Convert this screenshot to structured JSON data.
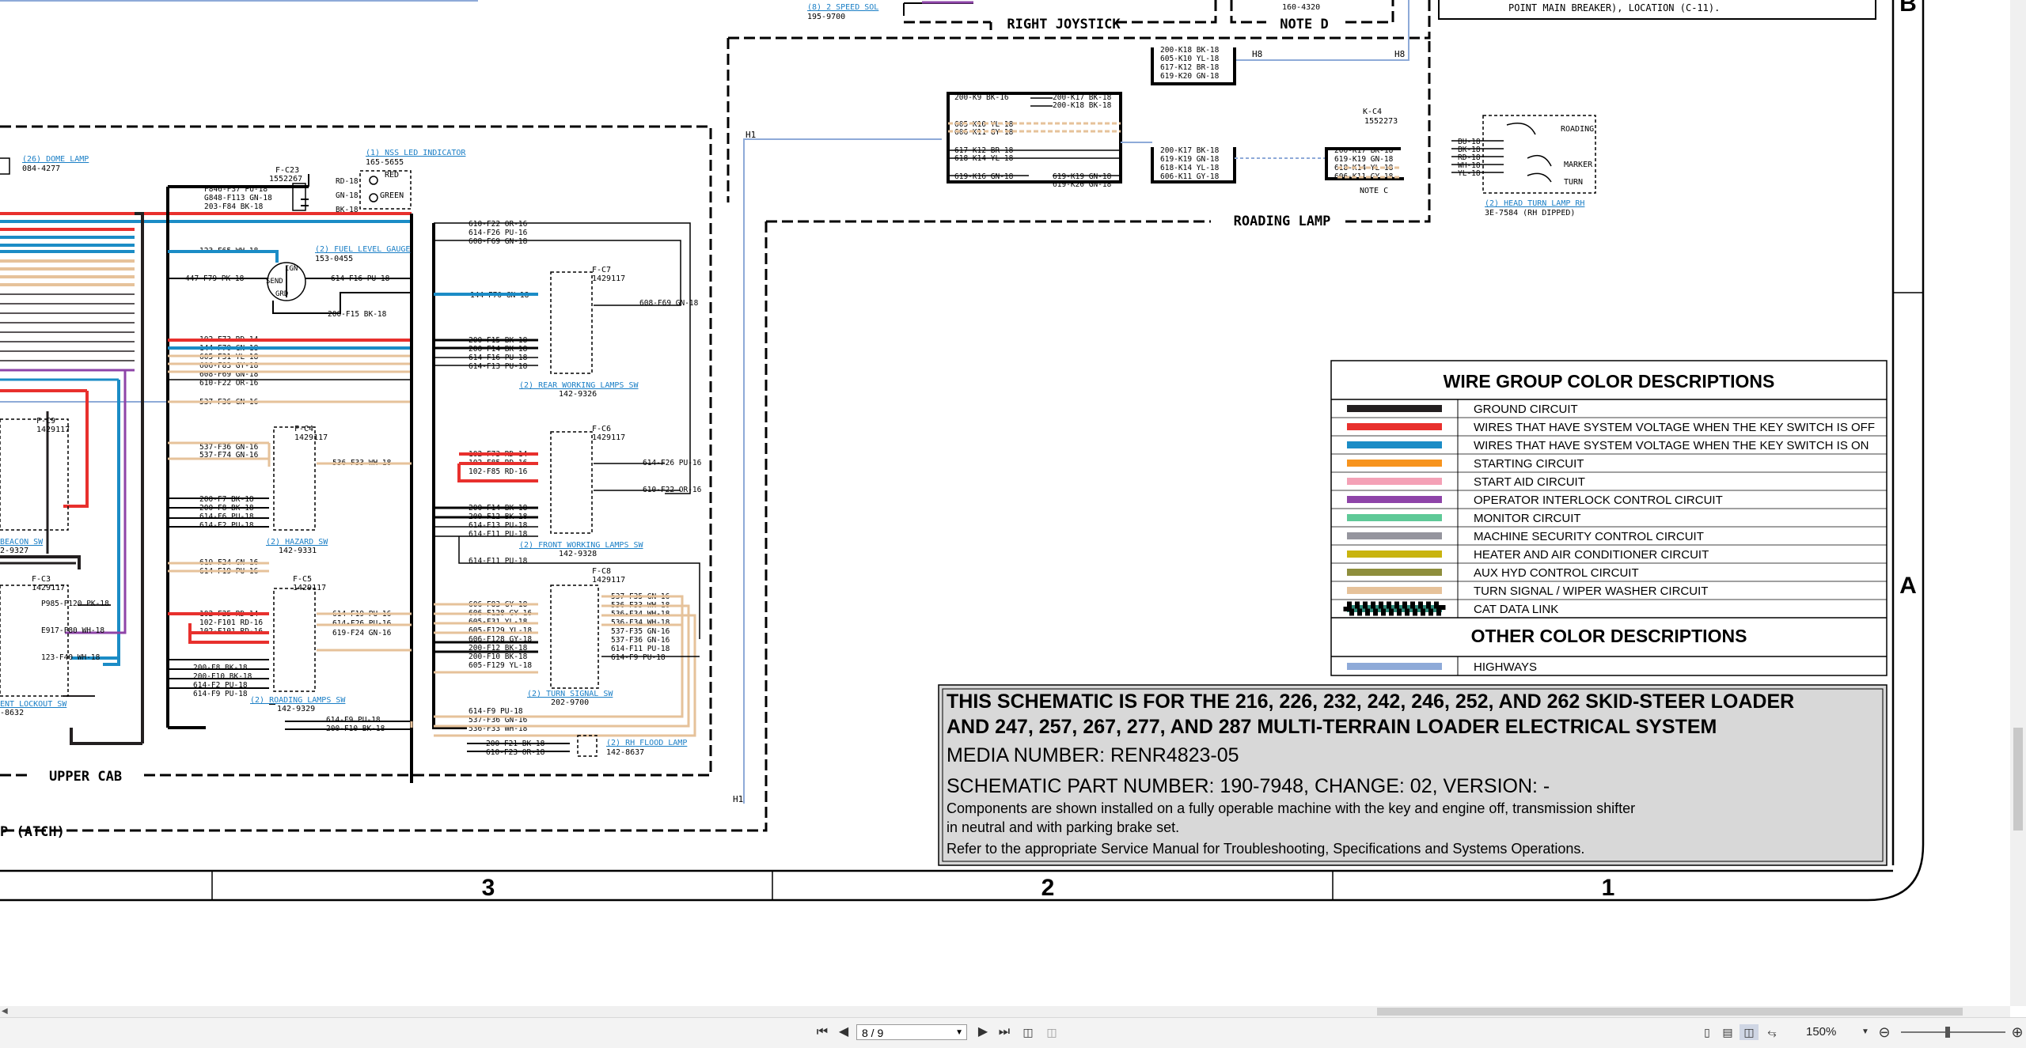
{
  "schematic": {
    "top_labels": {
      "speed_sol_link": "(8) 2 SPEED SOL",
      "speed_sol_part": "195-9700",
      "right_joystick": "RIGHT JOYSTICK",
      "note_d": "NOTE D",
      "part_160_4320": "160-4320",
      "main_breaker_note": "POINT MAIN BREAKER), LOCATION (C-11).",
      "h8_a": "H8",
      "h8_b": "H8",
      "h1_a": "H1",
      "h1_b": "H1",
      "roading_lamp": "ROADING LAMP",
      "upper_cab": "UPPER CAB",
      "atch": "P (ATCH)",
      "note_c": "NOTE C"
    },
    "zone_left": {
      "dome_lamp_link": "(26) DOME LAMP",
      "dome_lamp_part": "084-4277",
      "nss_led_link": "(1) NSS LED INDICATOR",
      "nss_led_part": "165-5655",
      "fc23": "F-C23",
      "fc23_part": "1552267",
      "red": "RED",
      "green": "GREEN",
      "fuel_gauge_link": "(2) FUEL LEVEL GAUGE",
      "fuel_gauge_part": "153-0455",
      "ign": "IGN",
      "send": "SEND",
      "grd": "GRD",
      "fc9": "F-C9",
      "fc9_part": "1429117",
      "fc4": "F-C4",
      "fc4_part": "1429117",
      "fc3": "F-C3",
      "fc3_part": "1429117",
      "fc5": "F-C5",
      "fc5_part": "1429117",
      "beacon_link": "BEACON SW",
      "beacon_part": "2-9327",
      "hazard_link": "(2) HAZARD SW",
      "hazard_part": "142-9331",
      "lockout_link": "ENT LOCKOUT SW",
      "lockout_part": "-8632",
      "roading_sw_link": "(2) ROADING LAMPS SW",
      "roading_sw_part": "142-9329"
    },
    "zone_mid": {
      "fc7": "F-C7",
      "fc7_part": "1429117",
      "rear_link": "(2) REAR WORKING LAMPS SW",
      "rear_part": "142-9326",
      "fc6": "F-C6",
      "fc6_part": "1429117",
      "front_link": "(2) FRONT WORKING LAMPS SW",
      "front_part": "142-9328",
      "fc8": "F-C8",
      "fc8_part": "1429117",
      "turn_link": "(2) TURN SIGNAL SW",
      "turn_part": "202-9700",
      "flood_link": "(2) RH FLOOD LAMP",
      "flood_part": "142-8637"
    },
    "zone_right": {
      "kc4": "K-C4",
      "kc4_part": "1552273",
      "head_turn_link": "(2) HEAD TURN LAMP RH",
      "head_turn_part": "3E-7584 (RH DIPPED)",
      "roading": "ROADING",
      "marker": "MARKER",
      "turn": "TURN"
    }
  },
  "wire_labels": {
    "z1_top": [
      "F846-F37 PU-18",
      "G848-F113 GN-18",
      "203-F84 BK-18"
    ],
    "z1_nss": [
      "RD-18",
      "GN-18",
      "BK-18"
    ],
    "z1_a": [
      "123-F65 WH-18"
    ],
    "z1_b": [
      "447-F79 PK-18"
    ],
    "z1_c": [
      "614-F16 PU-18",
      "200-F15 BK-18"
    ],
    "z1_bundle": [
      "102-F73 RD-14",
      "144-F70 GN-18",
      "605-F31 YL-18",
      "606-F83 GY-18",
      "608-F69 GN-18",
      "610-F22 OR-16"
    ],
    "z1_d": [
      "537-F36 GN-16"
    ],
    "z1_e": [
      "537-F36 GN-16",
      "537-F74 GN-16",
      "536-F33 WH-18"
    ],
    "z1_f": [
      "200-F7 BK-18",
      "200-F8 BK-18",
      "614-F6 PU-18",
      "614-F2 PU-18"
    ],
    "z1_g": [
      "619-F24 GN-16",
      "614-F19 PU-16"
    ],
    "z1_h": [
      "102-F25 RD-14",
      "102-F101 RD-16",
      "102-F101 RD-16"
    ],
    "z1_i": [
      "614-F19 PU-16",
      "614-F26 PU-16",
      "619-F24 GN-16"
    ],
    "z1_j": [
      "200-F8 BK-18",
      "200-F10 BK-18",
      "614-F2 PU-18",
      "614-F9 PU-18"
    ],
    "z1_k": [
      "P985-F120 PK-18",
      "E917-F80 WH-18",
      "123-F40 WH-18"
    ],
    "z1_l": [
      "614-F9 PU-18",
      "200-F10 BK-18"
    ],
    "z2_top": [
      "610-F22 OR-16",
      "614-F26 PU-16",
      "608-F69 GN-18"
    ],
    "z2_a": [
      "144-F70 GN-18",
      "608-F69 GN-18"
    ],
    "z2_b": [
      "200-F15 BK-18",
      "200-F14 BK-18",
      "614-F16 PU-18",
      "614-F13 PU-18"
    ],
    "z2_c": [
      "102-F73 RD-14",
      "102-F85 RD-16",
      "102-F85 RD-16",
      "614-F26 PU-16",
      "610-F22 OR-16"
    ],
    "z2_d": [
      "200-F14 BK-18",
      "200-F12 BK-18",
      "614-F13 PU-18",
      "614-F11 PU-18"
    ],
    "z2_e": [
      "614-F11 PU-18"
    ],
    "z2_f": [
      "606-F83 GY-18",
      "606-F128 GY-16",
      "605-F31 YL-18",
      "605-F129 YL-18",
      "606-F128 GY-18",
      "200-F12 BK-18",
      "200-F10 BK-18",
      "605-F129 YL-18"
    ],
    "z2_g": [
      "537-F35 GN-16",
      "536-F33 WH-18",
      "536-F34 WH-18",
      "536-F34 WH-18",
      "537-F35 GN-16",
      "537-F36 GN-16",
      "614-F11 PU-18",
      "614-F9 PU-18"
    ],
    "z2_h": [
      "614-F9 PU-18",
      "537-F36 GN-16",
      "536-F33 WH-18"
    ],
    "z2_i": [
      "200-F21 BK-18",
      "610-F23 OR-18"
    ],
    "z3_top": [
      "200-K18 BK-18",
      "605-K10 YL-18",
      "617-K12 BR-18",
      "619-K20 GN-18"
    ],
    "z3_a": [
      "200-K9 BK-16",
      "200-K17 BK-18",
      "200-K18 BK-18"
    ],
    "z3_b": [
      "605-K10 YL-18",
      "606-K11 GY-18"
    ],
    "z3_c": [
      "617-K12 BR-18",
      "618-K14 YL-18"
    ],
    "z3_d": [
      "619-K16 GN-18",
      "619-K19 GN-18",
      "619-K20 GN-18"
    ],
    "z3_e": [
      "200-K17 BK-18",
      "619-K19 GN-18",
      "618-K14 YL-18",
      "606-K11 GY-18"
    ],
    "z3_f": [
      "200-K17 BK-18",
      "619-K19 GN-18",
      "618-K14 YL-18",
      "606-K11 GY-18"
    ],
    "z3_g": [
      "BU-18",
      "BK-18",
      "RD-18",
      "WH-18",
      "YL-18"
    ]
  },
  "legend": {
    "title": "WIRE GROUP COLOR DESCRIPTIONS",
    "rows": [
      {
        "label": "GROUND CIRCUIT",
        "color": "#231f20"
      },
      {
        "label": "WIRES THAT HAVE SYSTEM VOLTAGE WHEN THE KEY SWITCH IS OFF",
        "color": "#e8302d"
      },
      {
        "label": "WIRES THAT HAVE SYSTEM VOLTAGE WHEN THE KEY SWITCH IS ON",
        "color": "#1b8cc6"
      },
      {
        "label": "STARTING CIRCUIT",
        "color": "#f7941e"
      },
      {
        "label": "START AID CIRCUIT",
        "color": "#f4a1b6"
      },
      {
        "label": "OPERATOR INTERLOCK CONTROL CIRCUIT",
        "color": "#8e44a8"
      },
      {
        "label": "MONITOR CIRCUIT",
        "color": "#5ec997"
      },
      {
        "label": "MACHINE SECURITY CONTROL CIRCUIT",
        "color": "#95959e"
      },
      {
        "label": "HEATER AND AIR CONDITIONER CIRCUIT",
        "color": "#c9b40f"
      },
      {
        "label": "AUX HYD CONTROL CIRCUIT",
        "color": "#8e8e3c"
      },
      {
        "label": "TURN SIGNAL / WIPER WASHER CIRCUIT",
        "color": "#e6c29a"
      },
      {
        "label": "CAT DATA LINK",
        "color": "#2e8b7a"
      }
    ],
    "other_title": "OTHER COLOR DESCRIPTIONS",
    "other_rows": [
      {
        "label": "HIGHWAYS",
        "color": "#8eaad8"
      }
    ]
  },
  "title_block": {
    "line1": "THIS SCHEMATIC IS FOR THE 216, 226, 232, 242, 246, 252, AND 262 SKID-STEER LOADER",
    "line2": "AND 247, 257, 267, 277, AND 287 MULTI-TERRAIN LOADER ELECTRICAL SYSTEM",
    "media": "MEDIA NUMBER: RENR4823-05",
    "part": "SCHEMATIC PART NUMBER: 190-7948, CHANGE: 02, VERSION: -",
    "note1": "Components are shown installed on a fully operable machine with the key and engine off, transmission shifter",
    "note2": "in neutral and with parking brake set.",
    "note3": "Refer to the appropriate Service Manual for Troubleshooting, Specifications and Systems Operations."
  },
  "grid": {
    "columns": [
      "3",
      "2",
      "1"
    ],
    "rows": [
      "B",
      "A"
    ]
  },
  "toolbar": {
    "first_icon": "first-page-icon",
    "prev_icon": "prev-page-icon",
    "page": "8 / 9",
    "next_icon": "next-page-icon",
    "last_icon": "last-page-icon",
    "zoom": "150%"
  }
}
